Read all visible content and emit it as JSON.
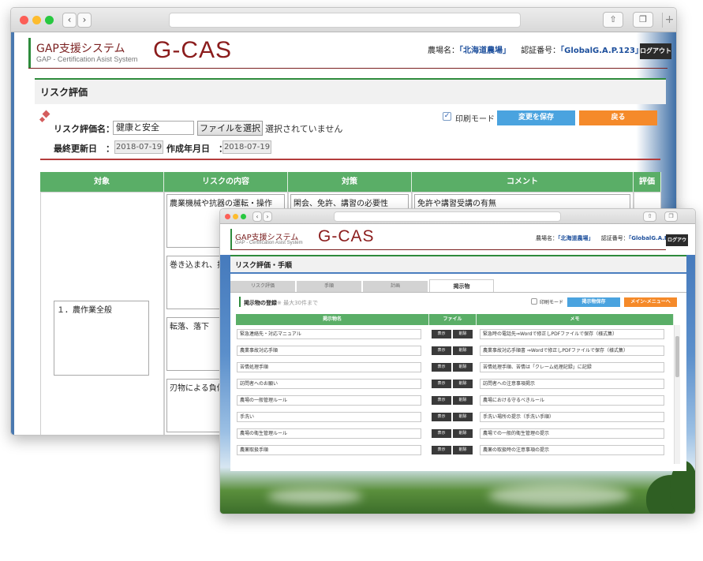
{
  "app": {
    "logo_jp": "GAP支援システム",
    "logo_en": "GAP - Certification Asist System",
    "logo_mark": "G-CAS",
    "farm_label": "農場名：",
    "farm_value": "「北海道農場」",
    "cert_label": "認証番号：",
    "cert_value": "「GlobalG.A.P.123」",
    "logout_label": "ログアウト"
  },
  "window1": {
    "section_title": "リスク評価",
    "form": {
      "name_label": "リスク評価名：",
      "name_value": "健康と安全",
      "file_button": "ファイルを選択",
      "file_status": "選択されていません",
      "updated_label": "最終更新日　：",
      "updated_value": "2018-07-19",
      "created_label": "作成年月日　：",
      "created_value": "2018-07-19",
      "print_mode_label": "印刷モード",
      "print_mode_checked": true,
      "save_button": "変更を保存",
      "back_button": "戻る"
    },
    "table": {
      "headers": [
        "対象",
        "リスクの内容",
        "対策",
        "コメント",
        "評価"
      ],
      "target_value": "１．農作業全般",
      "risk_items": [
        "農業機械や抗器の運転・操作",
        "巻き込まれ、挟",
        "転落、落下",
        "刃物による負傷"
      ],
      "measure_items": [
        "閑会、免許、講習の必要性"
      ],
      "comment_items": [
        "免許や講習受講の有無"
      ]
    }
  },
  "window2": {
    "section_title": "リスク評価・手順",
    "tabs": [
      {
        "label": "リスク評価",
        "active": false
      },
      {
        "label": "手順",
        "active": false
      },
      {
        "label": "計画",
        "active": false
      },
      {
        "label": "掲示物",
        "active": true
      }
    ],
    "sub_title": "掲示物の登録",
    "sub_note": "※ 最大30件まで",
    "print_mode_label": "印刷モード",
    "print_mode_checked": false,
    "save_button": "掲示物保存",
    "menu_button": "メイン-メニューへ",
    "table": {
      "headers": [
        "掲示物名",
        "ファイル",
        "メモ"
      ],
      "show_label": "表示",
      "delete_label": "削除",
      "rows": [
        {
          "name": "緊急連絡先・対応マニュアル",
          "memo": "緊急時の電話先⇒Wordで修正しPDFファイルで保存（様式集）"
        },
        {
          "name": "農業事故対応手順",
          "memo": "農業事故対応手順書 ⇒Wordで修正しPDFファイルで保存（様式集）"
        },
        {
          "name": "苦情処理手順",
          "memo": "苦情処理手順、苦情は「クレーム処理記録」に記録"
        },
        {
          "name": "訪問者へのお願い",
          "memo": "訪問者への注意事項掲示"
        },
        {
          "name": "農場の一般管理ルール",
          "memo": "農場における守るべきルール"
        },
        {
          "name": "手洗い",
          "memo": "手洗い場所の提示（手洗い手順）"
        },
        {
          "name": "農場の衛生管理ルール",
          "memo": "農場での一般的衛生管理の提示"
        },
        {
          "name": "農薬取扱手順",
          "memo": "農薬の取扱時の注意事項の提示"
        }
      ]
    }
  },
  "icons": {
    "back": "chevron-left-icon",
    "forward": "chevron-right-icon",
    "share": "share-icon",
    "tabs": "tabs-icon",
    "new_tab": "plus-icon"
  },
  "colors": {
    "green": "#5aae67",
    "brand_red": "#8b1c1c",
    "blue_button": "#4aa3df",
    "orange_button": "#f58a2a"
  }
}
